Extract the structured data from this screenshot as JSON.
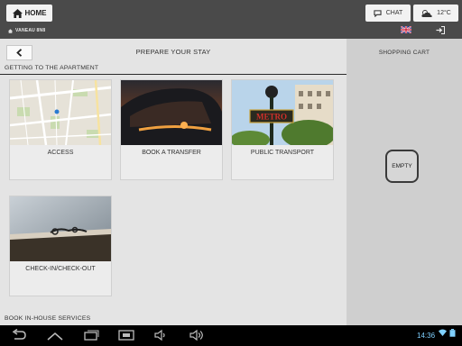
{
  "header": {
    "home_label": "HOME",
    "location": "VANEAU 8N8",
    "chat_label": "CHAT",
    "temperature": "12°C",
    "language": "en-GB"
  },
  "main": {
    "page_title": "PREPARE YOUR STAY",
    "section_apartment": "GETTING TO THE APARTMENT",
    "section_services": "BOOK IN-HOUSE SERVICES",
    "cards": [
      {
        "label": "ACCESS",
        "image": "street-map"
      },
      {
        "label": "BOOK A TRANSFER",
        "image": "car-sunset"
      },
      {
        "label": "PUBLIC TRANSPORT",
        "image": "metro-sign"
      },
      {
        "label": "CHECK-IN/CHECK-OUT",
        "image": "keys-on-table"
      }
    ]
  },
  "cart": {
    "title": "SHOPPING CART",
    "status": "EMPTY"
  },
  "system": {
    "clock": "14:36"
  },
  "colors": {
    "topbar": "#4a4a4a",
    "content_bg": "#e4e4e4",
    "cart_bg": "#cfcfcf",
    "navbar": "#000000",
    "clock": "#7fd0ff"
  }
}
